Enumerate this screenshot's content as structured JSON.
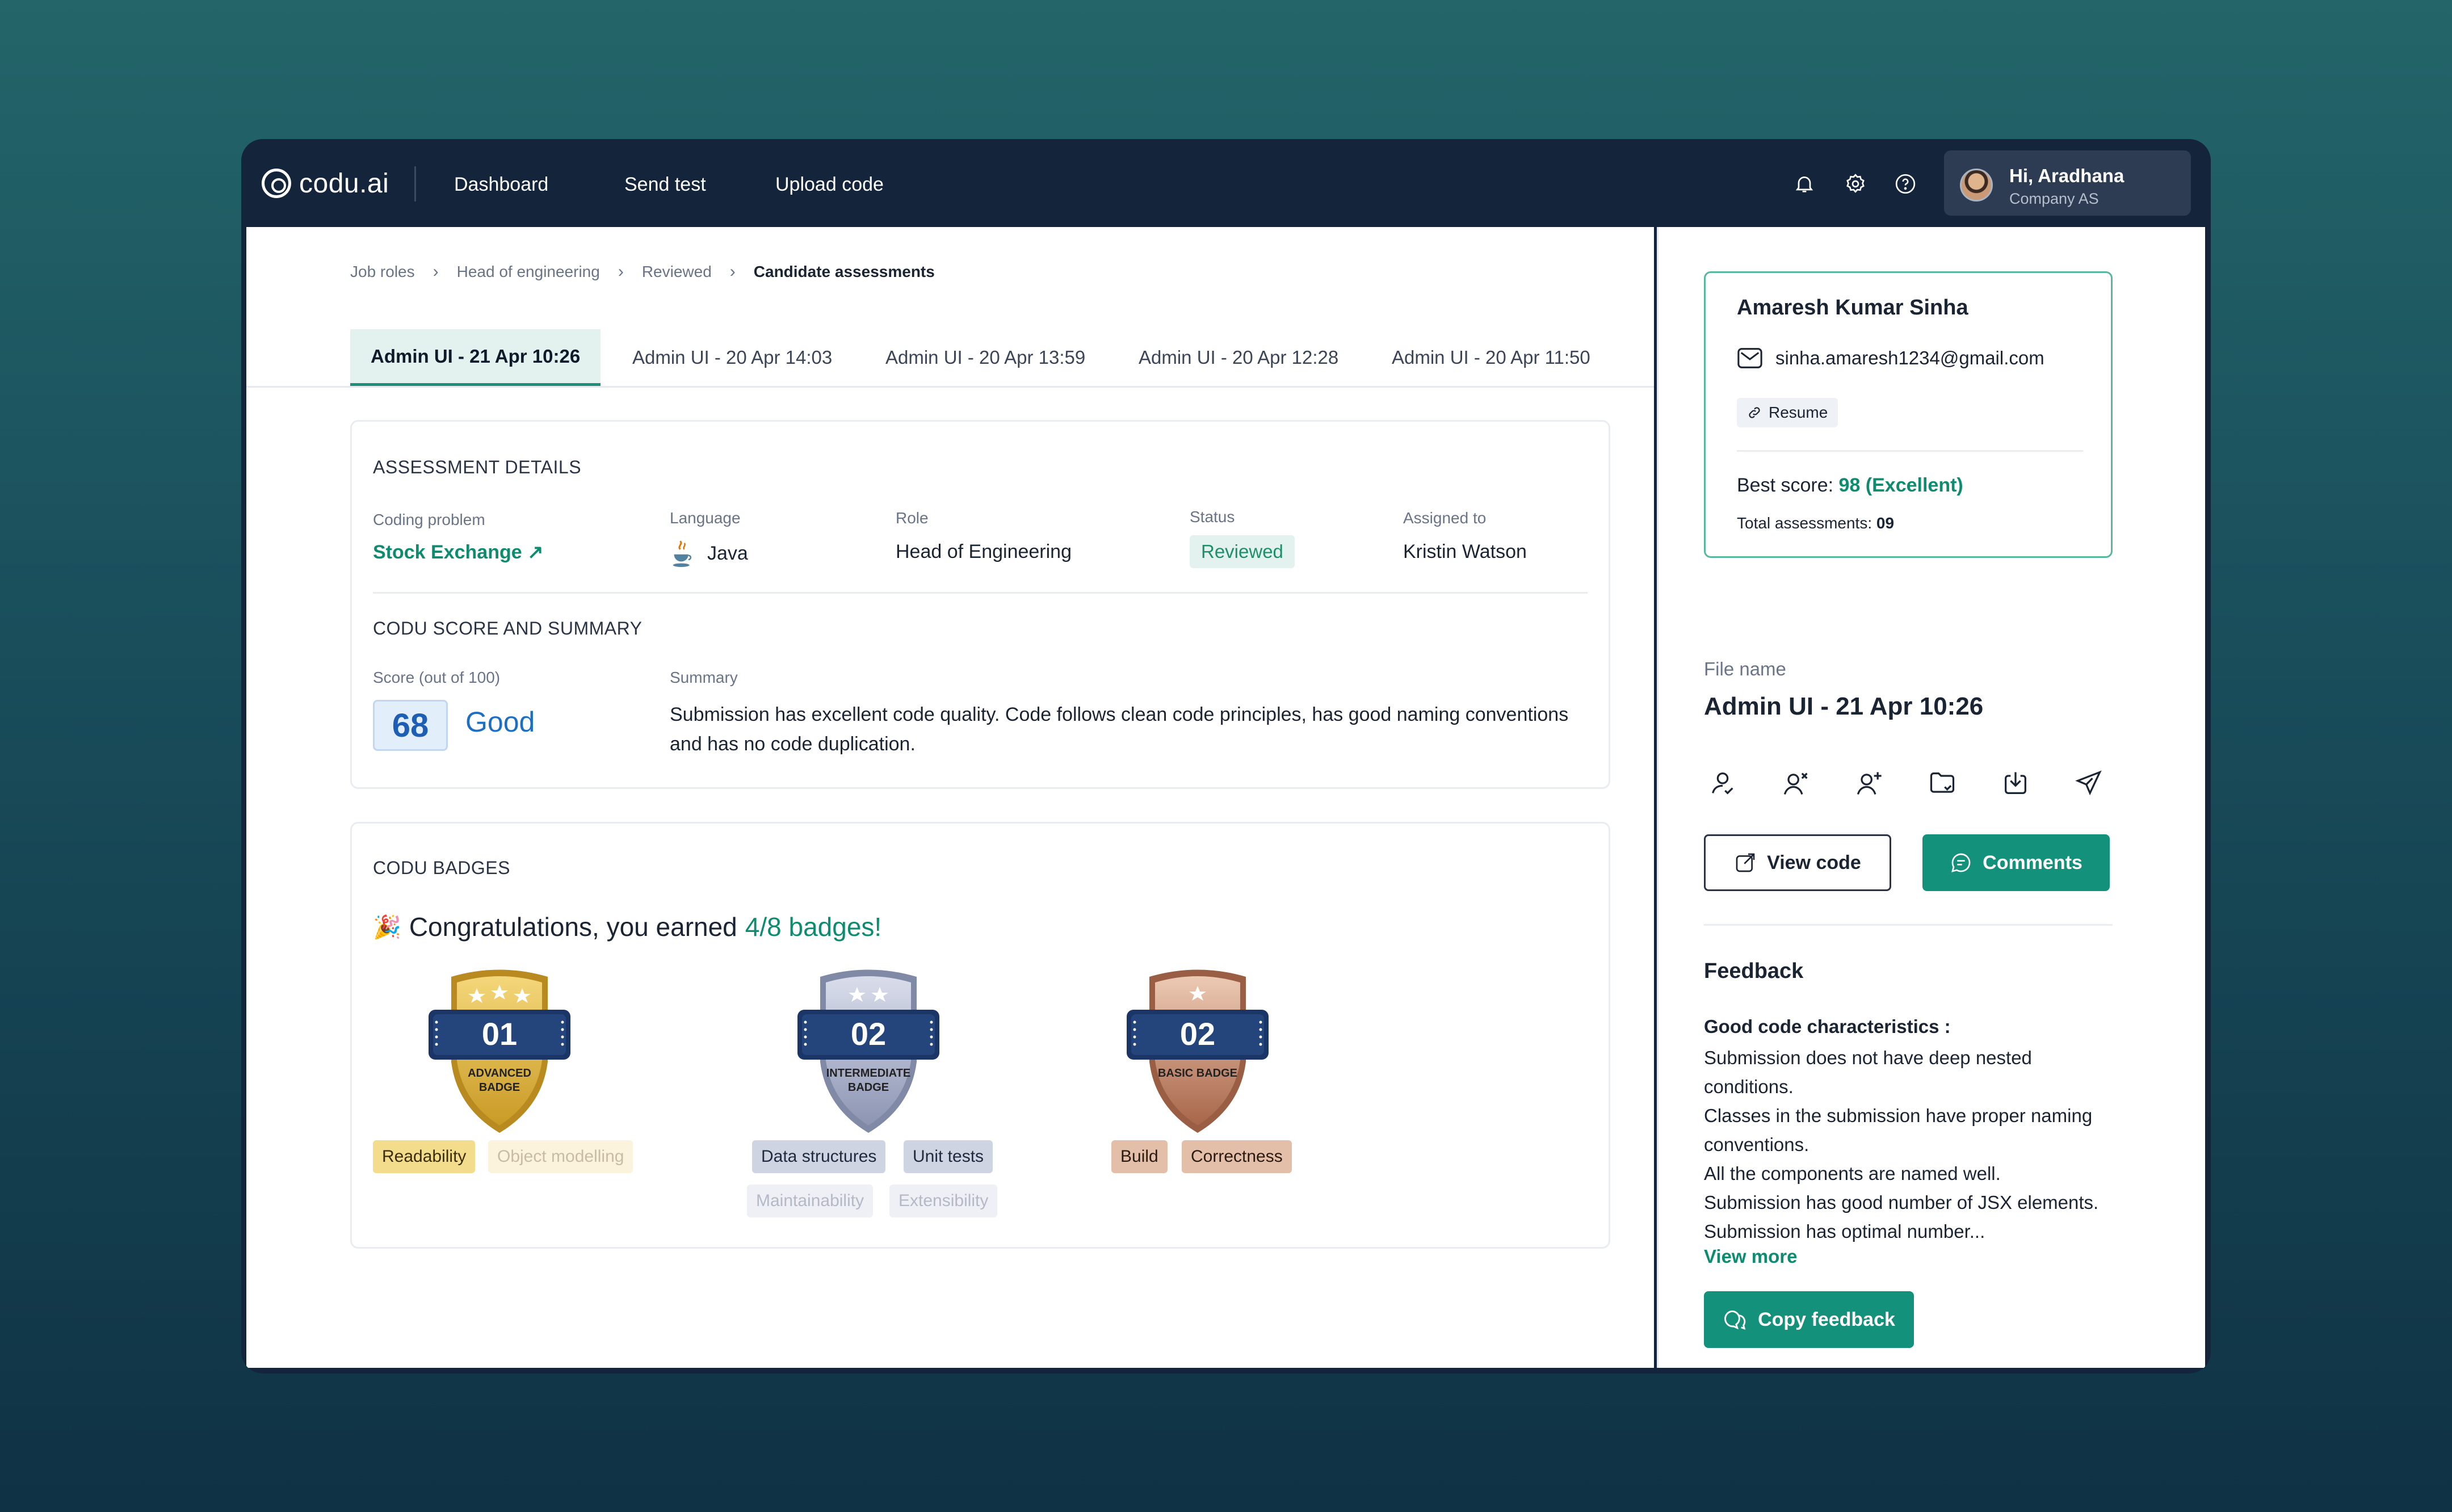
{
  "topbar": {
    "logo_text": "codu.ai",
    "nav": [
      "Dashboard",
      "Send test",
      "Upload code"
    ],
    "icons": [
      "bell-icon",
      "gear-icon",
      "help-icon"
    ],
    "user": {
      "greeting": "Hi, Aradhana",
      "company": "Company AS"
    }
  },
  "breadcrumb": [
    "Job roles",
    "Head of engineering",
    "Reviewed",
    "Candidate assessments"
  ],
  "tabs": [
    "Admin UI - 21 Apr 10:26",
    "Admin UI - 20 Apr 14:03",
    "Admin UI - 20 Apr 13:59",
    "Admin UI - 20 Apr 12:28",
    "Admin UI - 20 Apr 11:50"
  ],
  "assessment": {
    "title": "ASSESSMENT DETAILS",
    "labels": {
      "problem": "Coding problem",
      "language": "Language",
      "role": "Role",
      "status": "Status",
      "assigned": "Assigned to"
    },
    "problem": "Stock Exchange",
    "language": "Java",
    "role": "Head of Engineering",
    "status": "Reviewed",
    "assigned": "Kristin Watson"
  },
  "score": {
    "title": "CODU SCORE AND SUMMARY",
    "score_label": "Score (out of 100)",
    "summary_label": "Summary",
    "value": "68",
    "word": "Good",
    "summary": "Submission has excellent code quality. Code follows clean code principles, has good naming conventions and has no code duplication."
  },
  "badges": {
    "title": "CODU BADGES",
    "congrats_prefix": "Congratulations, you earned",
    "congrats_count": "4/8 badges!",
    "items": [
      {
        "number": "01",
        "name": "ADVANCED BADGE",
        "stars": 3,
        "tier": "gold",
        "tags_on": [
          "Readability"
        ],
        "tags_off": [
          "Object modelling"
        ]
      },
      {
        "number": "02",
        "name": "INTERMEDIATE BADGE",
        "stars": 2,
        "tier": "silver",
        "tags_on": [
          "Data structures",
          "Unit tests"
        ],
        "tags_off": [
          "Maintainability",
          "Extensibility"
        ]
      },
      {
        "number": "02",
        "name": "BASIC BADGE",
        "stars": 1,
        "tier": "bronze",
        "tags_on": [
          "Build",
          "Correctness"
        ],
        "tags_off": []
      }
    ]
  },
  "candidate": {
    "name": "Amaresh Kumar Sinha",
    "email": "sinha.amaresh1234@gmail.com",
    "resume": "Resume",
    "best_label": "Best score:",
    "best_value": "98 (Excellent)",
    "total_label": "Total assessments:",
    "total_value": "09"
  },
  "file": {
    "label": "File name",
    "value": "Admin UI - 21 Apr 10:26",
    "actions": [
      "user-check-icon",
      "user-remove-icon",
      "user-add-icon",
      "folder-icon",
      "download-icon",
      "send-icon"
    ],
    "view_code": "View code",
    "comments": "Comments"
  },
  "feedback": {
    "title": "Feedback",
    "heading": "Good code characteristics :",
    "lines": [
      "Submission does not have deep nested conditions.",
      "Classes in the submission have proper naming conventions.",
      "All the components are named well.",
      "Submission has good number of JSX elements. Submission has optimal number..."
    ],
    "view_more": "View more",
    "copy": "Copy feedback"
  },
  "colors": {
    "accent": "#13917a",
    "link": "#0f8b6f",
    "score_blue": "#1d6fc4",
    "nav_bg": "#14253b"
  }
}
